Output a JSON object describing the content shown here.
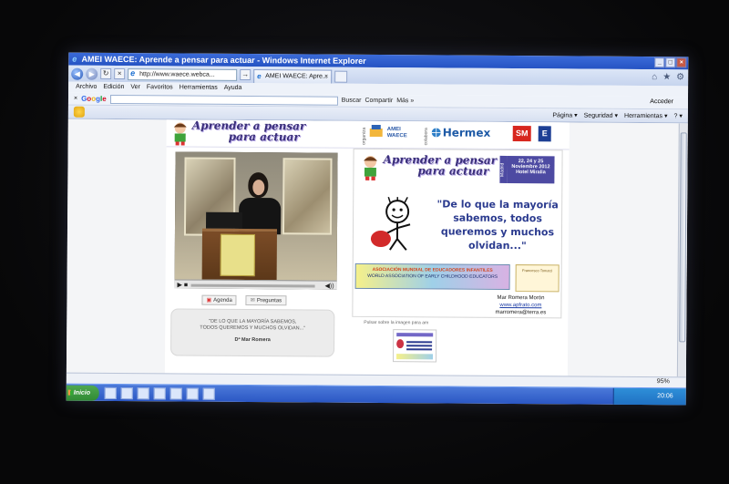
{
  "window": {
    "title": "AMEI WAECE: Aprende a pensar para actuar - Windows Internet Explorer",
    "minimize": "_",
    "maximize": "□",
    "close": "×"
  },
  "nav": {
    "back": "◀",
    "forward": "▶",
    "address": "http://www.waece.webca...",
    "go": "→",
    "stop": "×",
    "tab_title": "AMEI WAECE: Apre...",
    "tab_close": "×"
  },
  "menu": [
    "Archivo",
    "Edición",
    "Ver",
    "Favoritos",
    "Herramientas",
    "Ayuda"
  ],
  "google_bar": {
    "close": "×",
    "logo": [
      "G",
      "o",
      "o",
      "g",
      "l",
      "e"
    ],
    "buscar": "Buscar",
    "compartir": "Compartir",
    "mas": "Más »",
    "acceder": "Acceder"
  },
  "command_bar": {
    "items": [
      "Página ▾",
      "Seguridad ▾",
      "Herramientas ▾",
      "? ▾"
    ]
  },
  "page": {
    "banner_title_line1": "Aprender a pensar",
    "banner_title_line2": "para actuar",
    "organiza": "organiza",
    "amei_logo": "AMEI WAECE",
    "colabora": "colabora",
    "hermex": "Hermex",
    "sm": "SM",
    "eb": "E",
    "video_play": "▶ ■",
    "video_volume": "◀))",
    "btn_agenda": "Agenda",
    "btn_preguntas": "Preguntas",
    "quote_line1": "\"DE LO QUE LA MAYORÍA SABEMOS,",
    "quote_line2": "TODOS QUEREMOS Y MUCHOS OLVIDAN...\"",
    "quote_author": "Dª Mar Romera",
    "poster_title_line1": "Aprender a pensar",
    "poster_title_line2": "para actuar",
    "poster_madrid": "Madrid",
    "poster_date": "22, 24 y 25 Noviembre 2012 Hotel Miralia",
    "poster_quote": "\"De lo que la mayoría sabemos, todos queremos y muchos olvidan...\"",
    "assoc_line1": "ASOCIACIÓN MUNDIAL DE EDUCADORES INFANTILES",
    "assoc_line2": "WORLD ASSOCIATION OF EARLY CHILDHOOD EDUCATORS",
    "book_label": "Francesco Tonucci",
    "contact_name": "Mar Romera Morón",
    "contact_web": "www.apfrato.com",
    "contact_email": "marromera@terra.es",
    "thumb_caption": "Pulsar sobre la imagen para am"
  },
  "status": {
    "zoom": "95%"
  },
  "taskbar": {
    "start": "Inicio",
    "clock": "20:06"
  }
}
